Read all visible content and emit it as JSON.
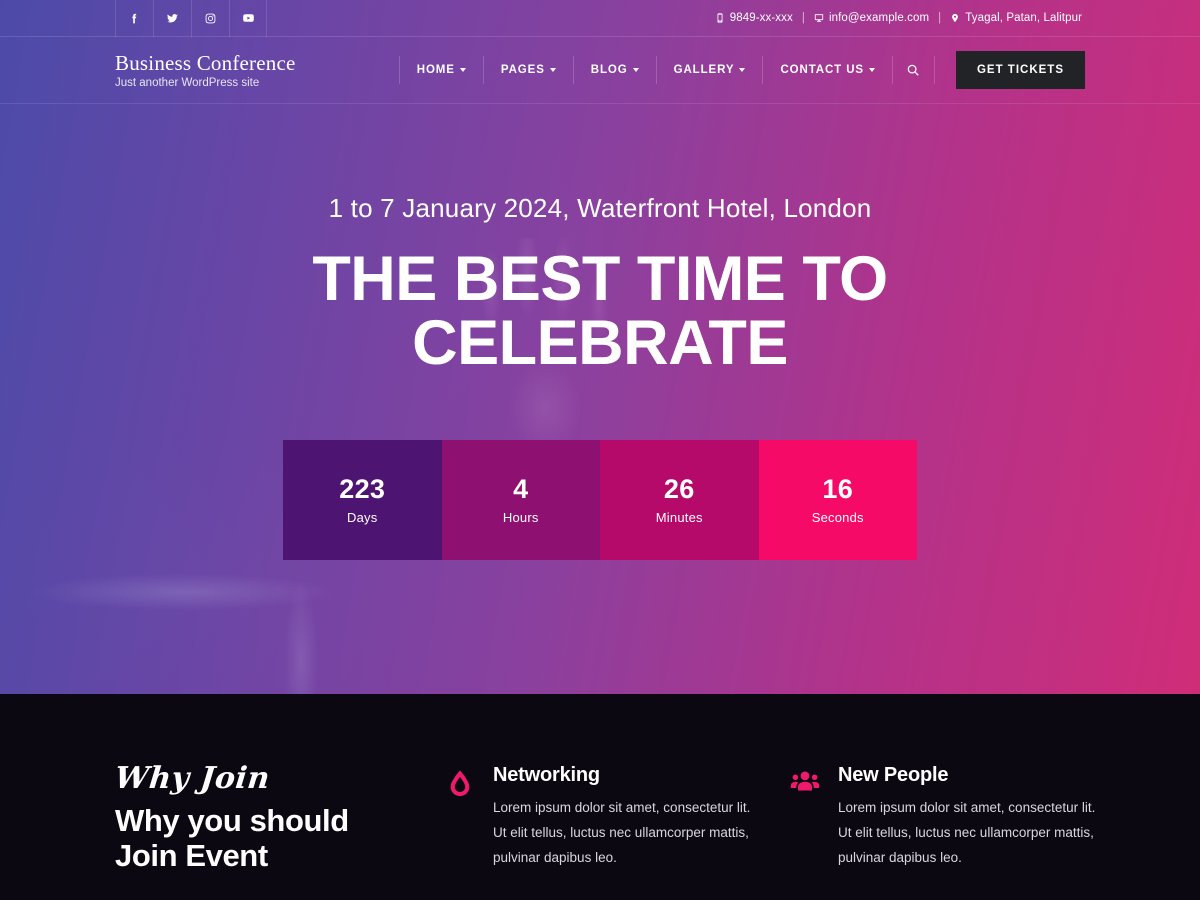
{
  "topbar": {
    "socials": [
      {
        "name": "facebook-icon",
        "label": "Facebook"
      },
      {
        "name": "twitter-icon",
        "label": "Twitter"
      },
      {
        "name": "instagram-icon",
        "label": "Instagram"
      },
      {
        "name": "youtube-icon",
        "label": "YouTube"
      }
    ],
    "phone": "9849-xx-xxx",
    "email": "info@example.com",
    "address": "Tyagal, Patan, Lalitpur",
    "separator": "|"
  },
  "header": {
    "site_title": "Business Conference",
    "tagline": "Just another WordPress site",
    "nav": [
      {
        "label": "HOME",
        "has_dropdown": true
      },
      {
        "label": "PAGES",
        "has_dropdown": true
      },
      {
        "label": "BLOG",
        "has_dropdown": true
      },
      {
        "label": "GALLERY",
        "has_dropdown": true
      },
      {
        "label": "CONTACT US",
        "has_dropdown": true
      }
    ],
    "search_label": "Search",
    "tickets_label": "GET TICKETS"
  },
  "hero": {
    "subtitle": "1 to 7 January 2024, Waterfront Hotel, London",
    "title_line1": "THE BEST TIME TO",
    "title_line2": "CELEBRATE"
  },
  "countdown": [
    {
      "value": "223",
      "label": "Days",
      "color": "#4d1472"
    },
    {
      "value": "4",
      "label": "Hours",
      "color": "#8e1171"
    },
    {
      "value": "26",
      "label": "Minutes",
      "color": "#b60a6a"
    },
    {
      "value": "16",
      "label": "Seconds",
      "color": "#f50a67"
    }
  ],
  "why_section": {
    "script_text": "Why Join",
    "heading_line1": "Why you should",
    "heading_line2": "Join Event",
    "features": [
      {
        "icon": "water-drop-icon",
        "title": "Networking",
        "body": "Lorem ipsum dolor sit amet, consectetur lit. Ut elit tellus, luctus nec ullamcorper mattis, pulvinar dapibus leo."
      },
      {
        "icon": "users-group-icon",
        "title": "New People",
        "body": "Lorem ipsum dolor sit amet, consectetur lit. Ut elit tellus, luctus nec ullamcorper mattis, pulvinar dapibus leo."
      }
    ]
  },
  "colors": {
    "gradient_start": "#4a4ba8",
    "gradient_end": "#d62b75",
    "accent_pink": "#ef1a6d",
    "dark_bg": "#0c0812",
    "button_dark": "#222326"
  }
}
